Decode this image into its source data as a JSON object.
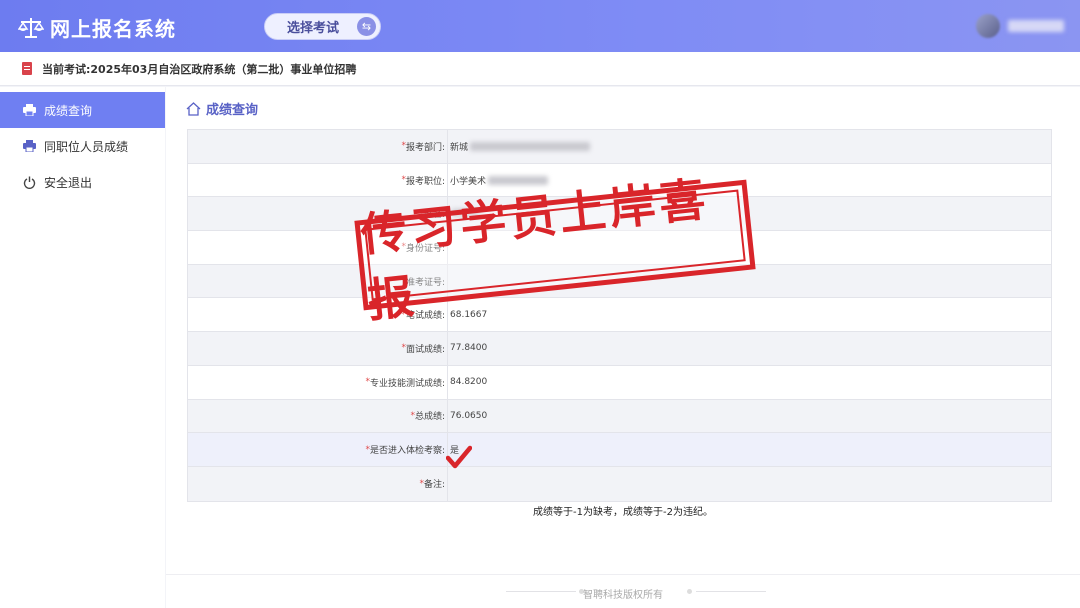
{
  "header": {
    "app_title": "网上报名系统",
    "select_exam_label": "选择考试"
  },
  "notice": {
    "label": "当前考试:",
    "exam_name": "2025年03月自治区政府系统（第二批）事业单位招聘"
  },
  "sidebar": {
    "items": [
      {
        "label": "成绩查询",
        "icon": "printer-icon",
        "active": true
      },
      {
        "label": "同职位人员成绩",
        "icon": "printer-icon",
        "active": false
      },
      {
        "label": "安全退出",
        "icon": "power-icon",
        "active": false
      }
    ]
  },
  "page": {
    "title": "成绩查询"
  },
  "form": {
    "rows": [
      {
        "label": "报考部门:",
        "value": "新城"
      },
      {
        "label": "报考职位:",
        "value": "小学美术"
      },
      {
        "label": "姓名:",
        "value": ""
      },
      {
        "label": "身份证号:",
        "value": ""
      },
      {
        "label": "准考证号:",
        "value": ""
      },
      {
        "label": "笔试成绩:",
        "value": "68.1667"
      },
      {
        "label": "面试成绩:",
        "value": "77.8400"
      },
      {
        "label": "专业技能测试成绩:",
        "value": "84.8200"
      },
      {
        "label": "总成绩:",
        "value": "76.0650"
      },
      {
        "label": "是否进入体检考察:",
        "value": "是"
      },
      {
        "label": "备注:",
        "value": ""
      }
    ]
  },
  "note": "成绩等于-1为缺考，成绩等于-2为违纪。",
  "footer": "智聘科技版权所有",
  "stamp": "传习学员上岸喜报",
  "colors": {
    "accent": "#6f7ff2",
    "stamp_red": "#d9252a",
    "required_star": "#e04a4a"
  }
}
